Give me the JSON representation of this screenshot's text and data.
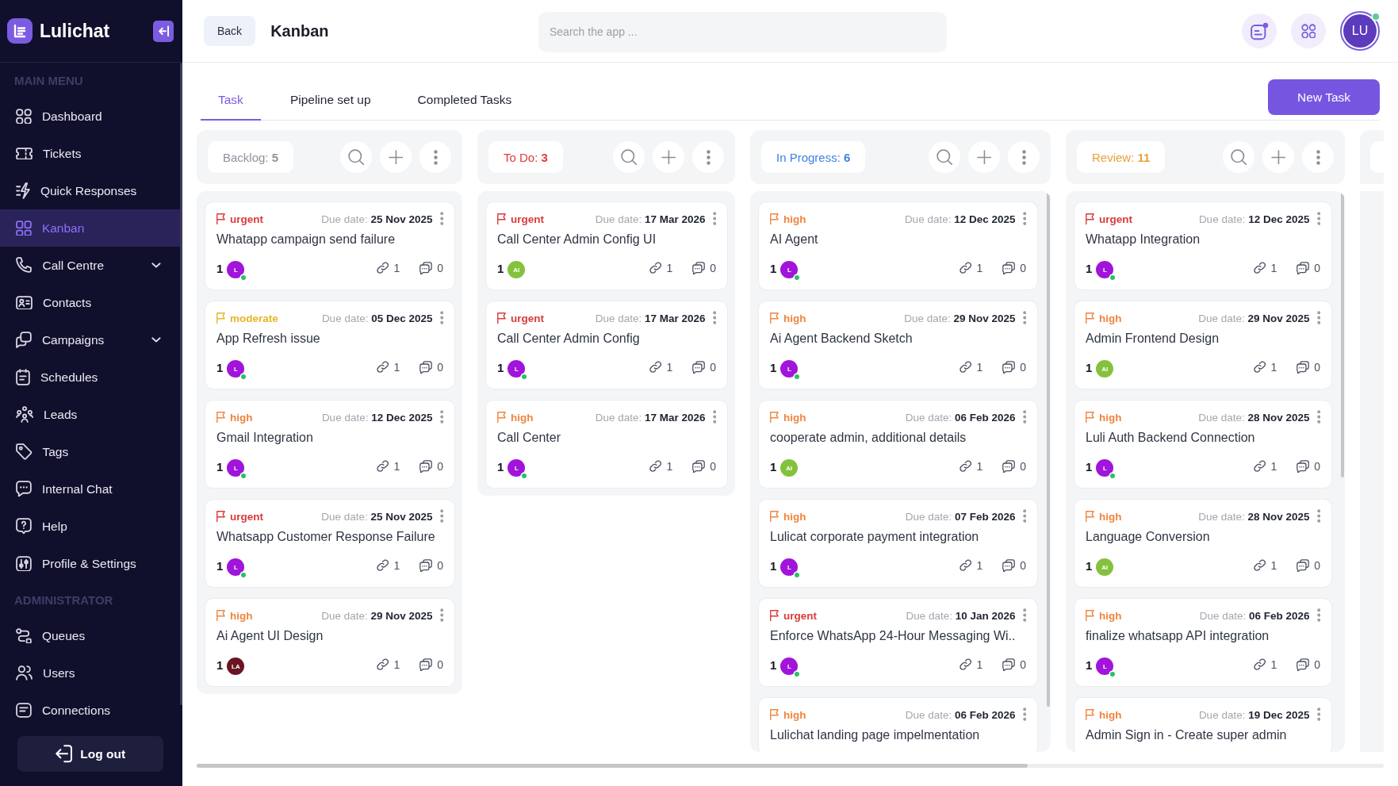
{
  "sidebar": {
    "brand": "Lulichat",
    "sections": [
      {
        "title": "MAIN MENU",
        "items": [
          {
            "label": "Dashboard",
            "selected": false,
            "submenu": false
          },
          {
            "label": "Tickets",
            "selected": false,
            "submenu": false
          },
          {
            "label": "Quick Responses",
            "selected": false,
            "submenu": false
          },
          {
            "label": "Kanban",
            "selected": true,
            "submenu": false
          },
          {
            "label": "Call Centre",
            "selected": false,
            "submenu": true
          },
          {
            "label": "Contacts",
            "selected": false,
            "submenu": false
          },
          {
            "label": "Campaigns",
            "selected": false,
            "submenu": true
          },
          {
            "label": "Schedules",
            "selected": false,
            "submenu": false
          },
          {
            "label": "Leads",
            "selected": false,
            "submenu": false
          },
          {
            "label": "Tags",
            "selected": false,
            "submenu": false
          },
          {
            "label": "Internal Chat",
            "selected": false,
            "submenu": false
          },
          {
            "label": "Help",
            "selected": false,
            "submenu": false
          },
          {
            "label": "Profile & Settings",
            "selected": false,
            "submenu": false
          }
        ]
      },
      {
        "title": "ADMINISTRATOR",
        "items": [
          {
            "label": "Queues",
            "selected": false,
            "submenu": false
          },
          {
            "label": "Users",
            "selected": false,
            "submenu": false
          },
          {
            "label": "Connections",
            "selected": false,
            "submenu": false
          }
        ]
      }
    ],
    "logout": "Log out"
  },
  "header": {
    "back": "Back",
    "title": "Kanban",
    "search": {
      "placeholder": "Search the app ..."
    },
    "user": {
      "initials": "LU",
      "online": true
    }
  },
  "tabs": [
    {
      "label": "Task",
      "selected": true
    },
    {
      "label": "Pipeline set up",
      "selected": false
    },
    {
      "label": "Completed Tasks",
      "selected": false
    }
  ],
  "new_task_button": "New Task",
  "board": {
    "columns": [
      {
        "title": "Backlog: **5**",
        "color": "#8e939b",
        "cards": [
          {
            "priority": {
              "label": "urgent",
              "color": "#d93b3b"
            },
            "due": "Due date: **25 Nov 2025**",
            "title": "Whatapp campaign send failure",
            "assignee_count": "1",
            "assignee": {
              "initials": "L",
              "color": "#a114da",
              "online": true
            },
            "links": "1",
            "comments": "0"
          },
          {
            "priority": {
              "label": "moderate",
              "color": "#e5b627"
            },
            "due": "Due date: **05 Dec 2025**",
            "title": "App Refresh issue",
            "assignee_count": "1",
            "assignee": {
              "initials": "L",
              "color": "#a114da",
              "online": true
            },
            "links": "1",
            "comments": "0"
          },
          {
            "priority": {
              "label": "high",
              "color": "#ef8640"
            },
            "due": "Due date: **12 Dec 2025**",
            "title": "Gmail Integration",
            "assignee_count": "1",
            "assignee": {
              "initials": "L",
              "color": "#a114da",
              "online": true
            },
            "links": "1",
            "comments": "0"
          },
          {
            "priority": {
              "label": "urgent",
              "color": "#d93b3b"
            },
            "due": "Due date: **25 Nov 2025**",
            "title": "Whatsapp Customer Response Failure",
            "assignee_count": "1",
            "assignee": {
              "initials": "L",
              "color": "#a114da",
              "online": true
            },
            "links": "1",
            "comments": "0"
          },
          {
            "priority": {
              "label": "high",
              "color": "#ef8640"
            },
            "due": "Due date: **29 Nov 2025**",
            "title": "Ai Agent UI Design",
            "assignee_count": "1",
            "assignee": {
              "initials": "LA",
              "color": "#6b1522",
              "online": false
            },
            "links": "1",
            "comments": "0"
          }
        ]
      },
      {
        "title": "To Do: **3**",
        "color": "#e03a3a",
        "cards": [
          {
            "priority": {
              "label": "urgent",
              "color": "#d93b3b"
            },
            "due": "Due date: **17 Mar 2026**",
            "title": "Call Center Admin Config UI",
            "assignee_count": "1",
            "assignee": {
              "initials": "AI",
              "color": "#84c13c",
              "online": false
            },
            "links": "1",
            "comments": "0"
          },
          {
            "priority": {
              "label": "urgent",
              "color": "#d93b3b"
            },
            "due": "Due date: **17 Mar 2026**",
            "title": "Call Center Admin Config",
            "assignee_count": "1",
            "assignee": {
              "initials": "L",
              "color": "#a114da",
              "online": true
            },
            "links": "1",
            "comments": "0"
          },
          {
            "priority": {
              "label": "high",
              "color": "#ef8640"
            },
            "due": "Due date: **17 Mar 2026**",
            "title": "Call Center",
            "assignee_count": "1",
            "assignee": {
              "initials": "L",
              "color": "#a114da",
              "online": true
            },
            "links": "1",
            "comments": "0"
          }
        ]
      },
      {
        "title": "In Progress: **6**",
        "color": "#3d7fe6",
        "cards": [
          {
            "priority": {
              "label": "high",
              "color": "#ef8640"
            },
            "due": "Due date: **12 Dec 2025**",
            "title": "AI Agent",
            "assignee_count": "1",
            "assignee": {
              "initials": "L",
              "color": "#a114da",
              "online": true
            },
            "links": "1",
            "comments": "0"
          },
          {
            "priority": {
              "label": "high",
              "color": "#ef8640"
            },
            "due": "Due date: **29 Nov 2025**",
            "title": "Ai Agent Backend Sketch",
            "assignee_count": "1",
            "assignee": {
              "initials": "L",
              "color": "#a114da",
              "online": true
            },
            "links": "1",
            "comments": "0"
          },
          {
            "priority": {
              "label": "high",
              "color": "#ef8640"
            },
            "due": "Due date: **06 Feb 2026**",
            "title": "cooperate admin, additional details",
            "assignee_count": "1",
            "assignee": {
              "initials": "AI",
              "color": "#84c13c",
              "online": false
            },
            "links": "1",
            "comments": "0"
          },
          {
            "priority": {
              "label": "high",
              "color": "#ef8640"
            },
            "due": "Due date: **07 Feb 2026**",
            "title": "Lulicat corporate payment integration",
            "assignee_count": "1",
            "assignee": {
              "initials": "L",
              "color": "#a114da",
              "online": true
            },
            "links": "1",
            "comments": "0"
          },
          {
            "priority": {
              "label": "urgent",
              "color": "#d93b3b"
            },
            "due": "Due date: **10 Jan 2026**",
            "title": "Enforce WhatsApp 24-Hour Messaging Wi..",
            "assignee_count": "1",
            "assignee": {
              "initials": "L",
              "color": "#a114da",
              "online": true
            },
            "links": "1",
            "comments": "0"
          },
          {
            "priority": {
              "label": "high",
              "color": "#ef8640"
            },
            "due": "Due date: **06 Feb 2026**",
            "title": "Lulichat landing page impelmentation"
          }
        ]
      },
      {
        "title": "Review: **11**",
        "color": "#e6a23c",
        "cards": [
          {
            "priority": {
              "label": "urgent",
              "color": "#d93b3b"
            },
            "due": "Due date: **12 Dec 2025**",
            "title": "Whatapp Integration",
            "assignee_count": "1",
            "assignee": {
              "initials": "L",
              "color": "#a114da",
              "online": true
            },
            "links": "1",
            "comments": "0"
          },
          {
            "priority": {
              "label": "high",
              "color": "#ef8640"
            },
            "due": "Due date: **29 Nov 2025**",
            "title": "Admin Frontend Design",
            "assignee_count": "1",
            "assignee": {
              "initials": "AI",
              "color": "#84c13c",
              "online": false
            },
            "links": "1",
            "comments": "0"
          },
          {
            "priority": {
              "label": "high",
              "color": "#ef8640"
            },
            "due": "Due date: **28 Nov 2025**",
            "title": "Luli Auth Backend Connection",
            "assignee_count": "1",
            "assignee": {
              "initials": "L",
              "color": "#a114da",
              "online": true
            },
            "links": "1",
            "comments": "0"
          },
          {
            "priority": {
              "label": "high",
              "color": "#ef8640"
            },
            "due": "Due date: **28 Nov 2025**",
            "title": "Language Conversion",
            "assignee_count": "1",
            "assignee": {
              "initials": "AI",
              "color": "#84c13c",
              "online": false
            },
            "links": "1",
            "comments": "0"
          },
          {
            "priority": {
              "label": "high",
              "color": "#ef8640"
            },
            "due": "Due date: **06 Feb 2026**",
            "title": "finalize whatsapp API integration",
            "assignee_count": "1",
            "assignee": {
              "initials": "L",
              "color": "#a114da",
              "online": true
            },
            "links": "1",
            "comments": "0"
          },
          {
            "priority": {
              "label": "high",
              "color": "#ef8640"
            },
            "due": "Due date: **19 Dec 2025**",
            "title": "Admin Sign in - Create super admin"
          }
        ]
      }
    ],
    "clipped_column": true
  }
}
